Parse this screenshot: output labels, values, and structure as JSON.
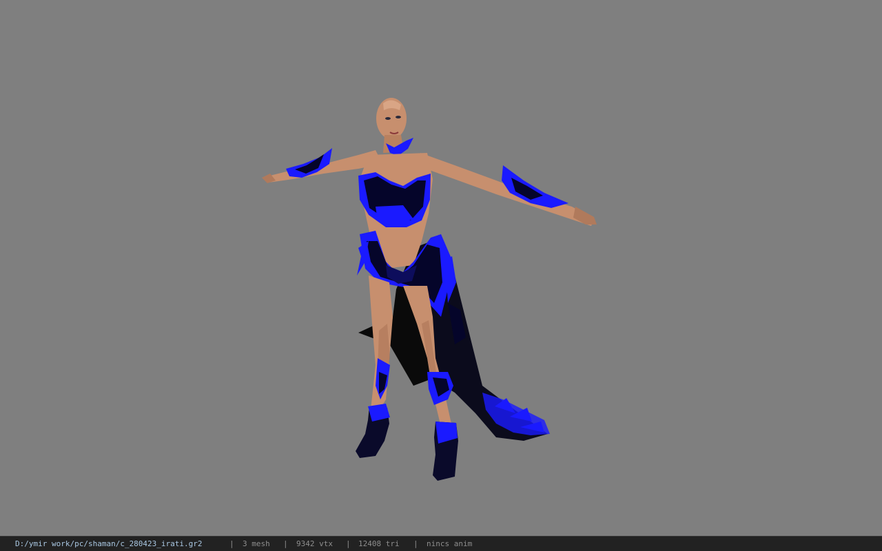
{
  "viewport": {
    "background_color": "#7f7f7f",
    "model_description_icon": "character-model-icon",
    "colors": {
      "skin": "#c78f6e",
      "skin_shadow": "#a86f52",
      "armor_blue": "#1a1aff",
      "armor_dark": "#05052a",
      "cape_black": "#0a0a0a"
    }
  },
  "status": {
    "file_path": "D:/ymir work/pc/shaman/c_280423_irati.gr2",
    "separator": "|",
    "mesh_count": "3 mesh",
    "vertex_count": "9342 vtx",
    "triangle_count": "12408 tri",
    "animation": "nincs anim"
  }
}
